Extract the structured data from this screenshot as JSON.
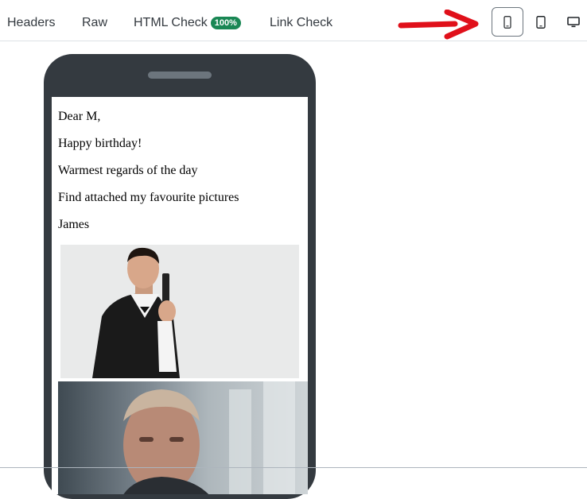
{
  "tabs": [
    {
      "label": "Headers"
    },
    {
      "label": "Raw"
    },
    {
      "label": "HTML Check",
      "badge": "100%"
    },
    {
      "label": "Link Check"
    }
  ],
  "device_buttons": [
    {
      "icon": "mobile-icon",
      "selected": true
    },
    {
      "icon": "tablet-icon",
      "selected": false
    },
    {
      "icon": "desktop-icon",
      "selected": false
    }
  ],
  "annotation": {
    "icon": "red-arrow-icon",
    "color": "#e0101a"
  },
  "email": {
    "lines": [
      "Dear M,",
      "Happy birthday!",
      "Warmest regards of the day",
      "Find attached my favourite pictures",
      "James"
    ],
    "images": [
      "man-in-tuxedo-with-pistol-photo",
      "man-portrait-photo"
    ]
  },
  "colors": {
    "badge": "#198754",
    "phone_frame": "#343a40",
    "arrow": "#e0101a"
  }
}
